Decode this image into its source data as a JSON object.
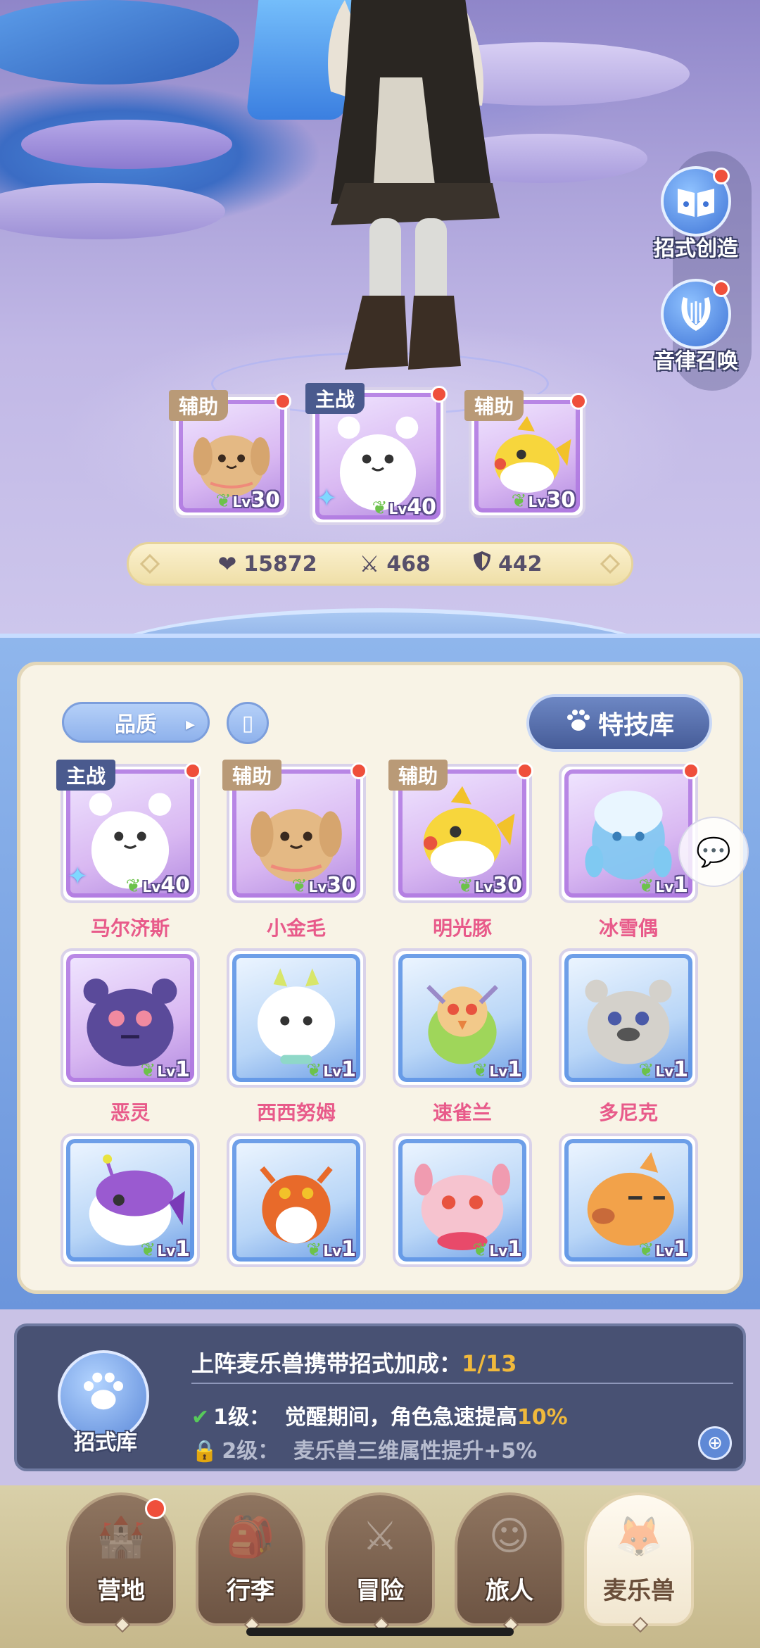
{
  "side_buttons": [
    {
      "label": "招式创造",
      "icon": "book-music-icon",
      "badge": true
    },
    {
      "label": "音律召唤",
      "icon": "lyre-icon",
      "badge": true
    }
  ],
  "active_team": [
    {
      "tag": "辅助",
      "level": "30",
      "creature": "golden-pup"
    },
    {
      "tag": "主战",
      "level": "40",
      "creature": "white-bear"
    },
    {
      "tag": "辅助",
      "level": "30",
      "creature": "yellow-fish"
    }
  ],
  "stats": {
    "hp": "15872",
    "attack": "468",
    "defense": "442"
  },
  "filter": {
    "quality_label": "品质",
    "skill_library_label": "特技库"
  },
  "pets": [
    {
      "name": "马尔济斯",
      "level": "40",
      "tag": "主战",
      "frame": "purple",
      "badge": true,
      "creature": "white-bear"
    },
    {
      "name": "小金毛",
      "level": "30",
      "tag": "辅助",
      "frame": "purple",
      "badge": true,
      "creature": "golden-pup"
    },
    {
      "name": "明光豚",
      "level": "30",
      "tag": "辅助",
      "frame": "purple",
      "badge": true,
      "creature": "yellow-fish"
    },
    {
      "name": "冰雪偶",
      "level": "1",
      "tag": "",
      "frame": "purple",
      "badge": true,
      "creature": "ice-blob"
    },
    {
      "name": "恶灵",
      "level": "1",
      "tag": "",
      "frame": "purple",
      "badge": false,
      "creature": "purple-bear"
    },
    {
      "name": "西西努姆",
      "level": "1",
      "tag": "",
      "frame": "blue",
      "badge": false,
      "creature": "white-ghost"
    },
    {
      "name": "速雀兰",
      "level": "1",
      "tag": "",
      "frame": "blue",
      "badge": false,
      "creature": "green-bird"
    },
    {
      "name": "多尼克",
      "level": "1",
      "tag": "",
      "frame": "blue",
      "badge": false,
      "creature": "grey-bear"
    },
    {
      "name": "",
      "level": "1",
      "tag": "",
      "frame": "blue",
      "badge": false,
      "creature": "purple-fish"
    },
    {
      "name": "",
      "level": "1",
      "tag": "",
      "frame": "blue",
      "badge": false,
      "creature": "orange-lizard"
    },
    {
      "name": "",
      "level": "1",
      "tag": "",
      "frame": "blue",
      "badge": false,
      "creature": "pink-axolotl"
    },
    {
      "name": "",
      "level": "1",
      "tag": "",
      "frame": "blue",
      "badge": false,
      "creature": "orange-pig"
    }
  ],
  "info_bar": {
    "library_label": "招式库",
    "headline": "上阵麦乐兽携带招式加成：",
    "progress": "1/13",
    "level1_prefix": "1级：",
    "level1_text": "觉醒期间，角色急速提高",
    "level1_value": "10%",
    "level2_prefix": "2级：",
    "level2_text": "麦乐兽三维属性提升+5%"
  },
  "nav": [
    {
      "label": "营地",
      "icon": "castle-icon",
      "badge": true,
      "active": false
    },
    {
      "label": "行李",
      "icon": "backpack-icon",
      "badge": false,
      "active": false
    },
    {
      "label": "冒险",
      "icon": "crossed-swords-icon",
      "badge": false,
      "active": false
    },
    {
      "label": "旅人",
      "icon": "traveler-icon",
      "badge": false,
      "active": false
    },
    {
      "label": "麦乐兽",
      "icon": "fox-icon",
      "badge": false,
      "active": true
    }
  ],
  "colors": {
    "badge_red": "#ef4f3b",
    "pet_name": "#e85a8a",
    "progress_gold": "#f0b93c"
  }
}
